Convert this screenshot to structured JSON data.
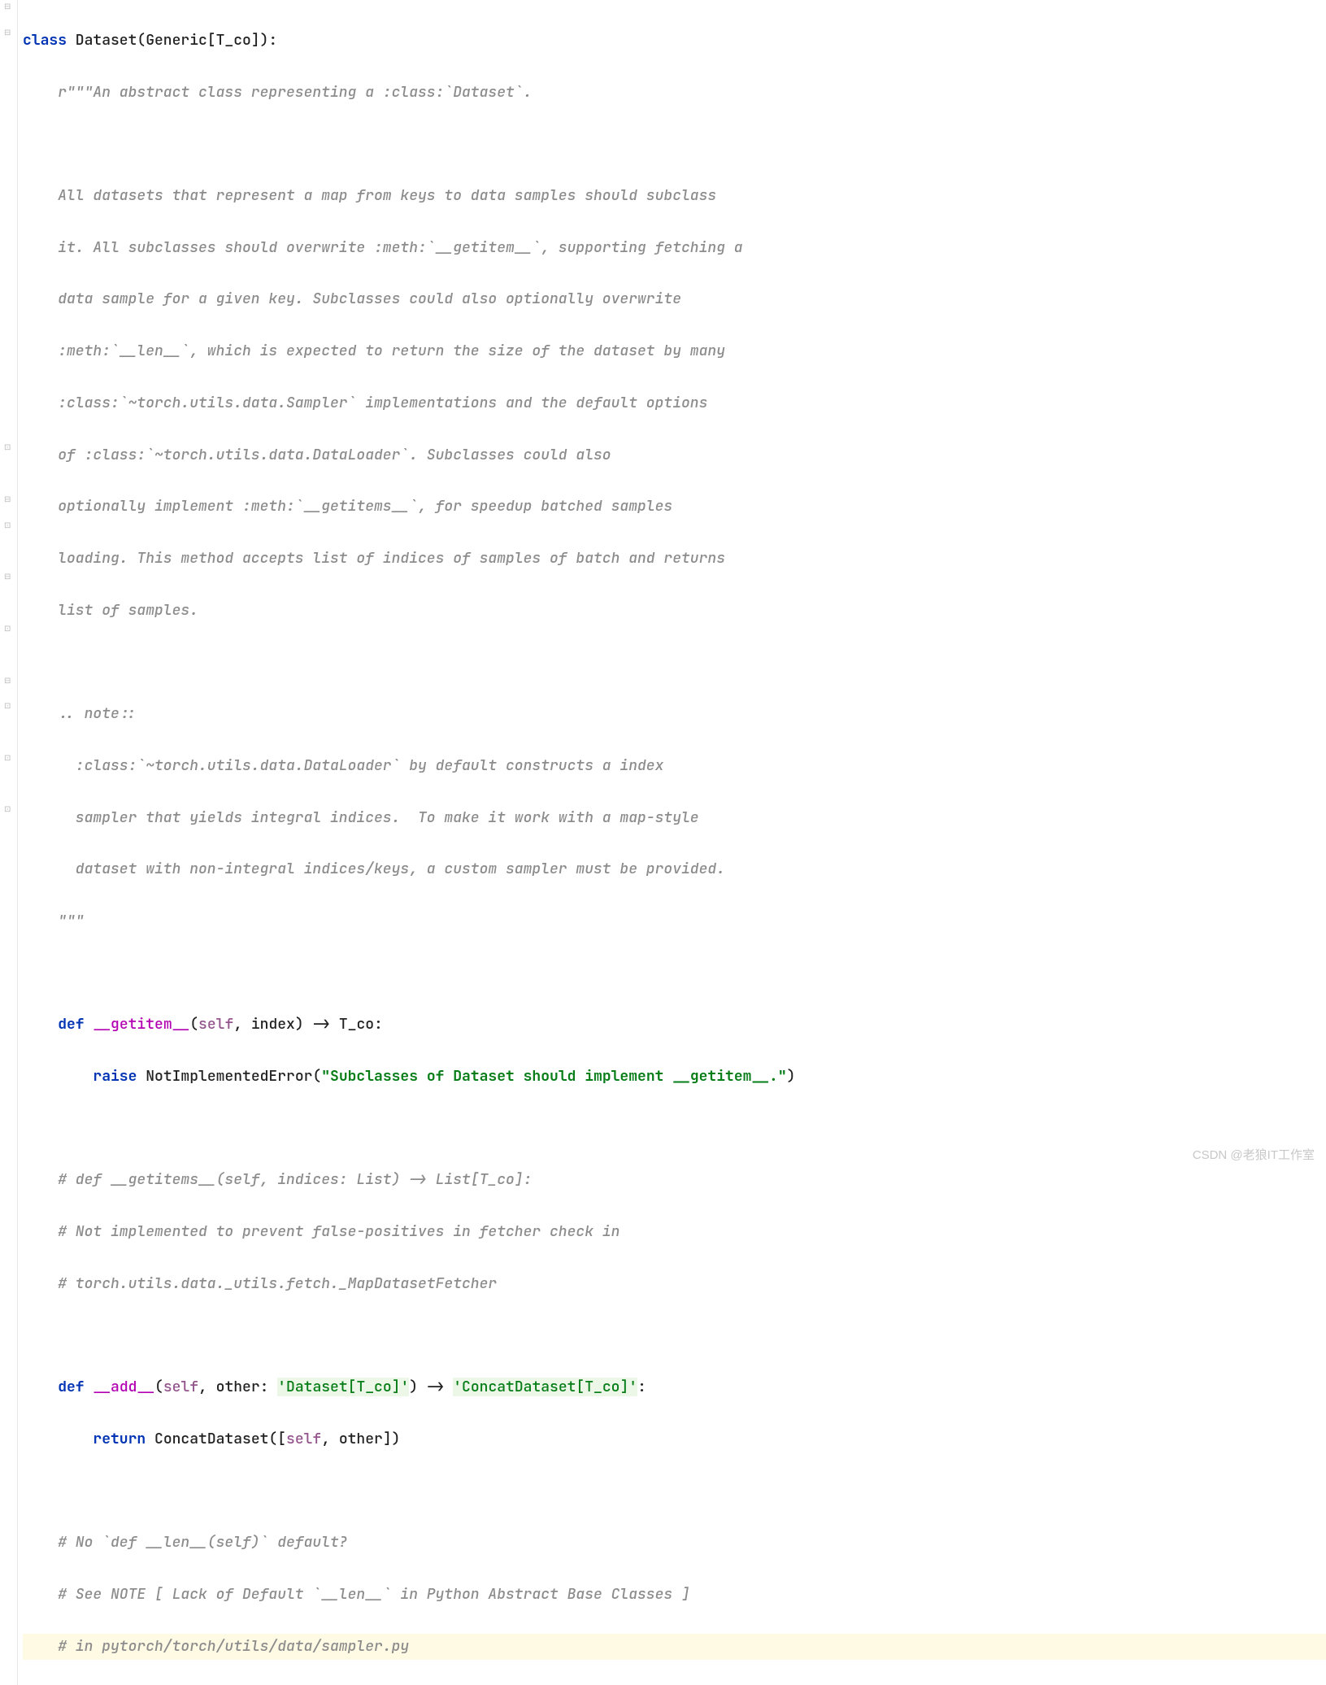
{
  "code": {
    "l1_kw_class": "class",
    "l1_name": " Dataset(Generic[T_co]):",
    "l2_doc": "    r\"\"\"An abstract class representing a :class:`Dataset`.",
    "l3_doc": "",
    "l4_doc": "    All datasets that represent a map from keys to data samples should subclass",
    "l5_doc": "    it. All subclasses should overwrite :meth:`__getitem__`, supporting fetching a",
    "l6_doc": "    data sample for a given key. Subclasses could also optionally overwrite",
    "l7_doc": "    :meth:`__len__`, which is expected to return the size of the dataset by many",
    "l8_doc": "    :class:`~torch.utils.data.Sampler` implementations and the default options",
    "l9_doc": "    of :class:`~torch.utils.data.DataLoader`. Subclasses could also",
    "l10_doc": "    optionally implement :meth:`__getitems__`, for speedup batched samples",
    "l11_doc": "    loading. This method accepts list of indices of samples of batch and returns",
    "l12_doc": "    list of samples.",
    "l13_doc": "",
    "l14_doc": "    .. note::",
    "l15_doc": "      :class:`~torch.utils.data.DataLoader` by default constructs a index",
    "l16_doc": "      sampler that yields integral indices.  To make it work with a map-style",
    "l17_doc": "      dataset with non-integral indices/keys, a custom sampler must be provided.",
    "l18_doc": "    \"\"\"",
    "l19": "",
    "l20_indent": "    ",
    "l20_kw_def": "def",
    "l20_sp1": " ",
    "l20_fn": "__getitem__",
    "l20_paren_open": "(",
    "l20_self": "self",
    "l20_rest": ", index) -> T_co:",
    "l21_indent": "        ",
    "l21_kw_raise": "raise",
    "l21_sp": " ",
    "l21_err": "NotImplementedError(",
    "l21_str": "\"Subclasses of Dataset should implement __getitem__.\"",
    "l21_close": ")",
    "l22": "",
    "l23_cmt": "    # def __getitems__(self, indices: List) -> List[T_co]:",
    "l24_cmt": "    # Not implemented to prevent false-positives in fetcher check in",
    "l25_cmt": "    # torch.utils.data._utils.fetch._MapDatasetFetcher",
    "l26": "",
    "l27_indent": "    ",
    "l27_kw_def": "def",
    "l27_sp1": " ",
    "l27_fn": "__add__",
    "l27_paren_open": "(",
    "l27_self": "self",
    "l27_mid": ", other: ",
    "l27_strlit1": "'Dataset[T_co]'",
    "l27_arrow": ") -> ",
    "l27_strlit2": "'ConcatDataset[T_co]'",
    "l27_colon": ":",
    "l28_indent": "        ",
    "l28_kw_return": "return",
    "l28_sp": " ",
    "l28_call": "ConcatDataset([",
    "l28_self": "self",
    "l28_rest": ", other])",
    "l29": "",
    "l30_cmt": "    # No `def __len__(self)` default?",
    "l31_cmt": "    # See NOTE [ Lack of Default `__len__` in Python Abstract Base Classes ]",
    "l32_cmt": "    # in pytorch/torch/utils/data/sampler.py"
  },
  "fold_markers": {
    "m1": "⊟",
    "m2": "⊟",
    "m3": "⊡",
    "m4": "⊟",
    "m5": "⊡",
    "m6": "⊟",
    "m7": "⊡",
    "m8": "⊟",
    "m9": "⊡",
    "m10": "⊡",
    "m11": "⊡"
  },
  "watermark": "CSDN @老狼IT工作室"
}
